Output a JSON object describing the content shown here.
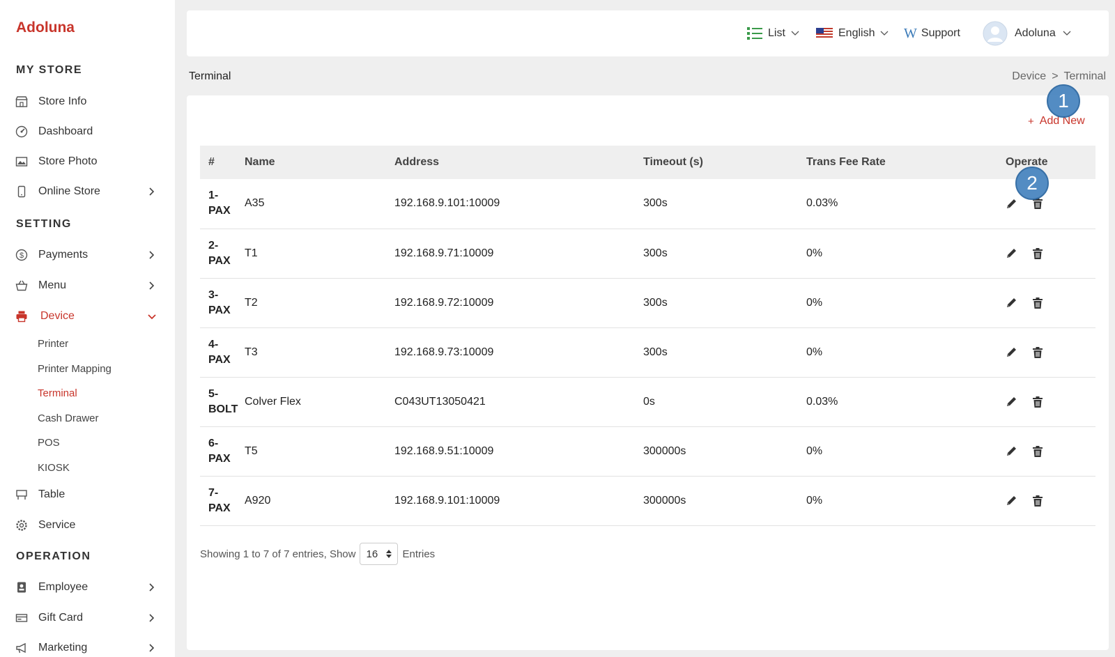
{
  "brand": "Adoluna",
  "colors": {
    "accent": "#c8352b",
    "badge": "#4a86c0"
  },
  "sidebar": {
    "sections": [
      "MY STORE",
      "SETTING",
      "OPERATION"
    ],
    "my_store": [
      {
        "label": "Store Info",
        "icon": "store-icon"
      },
      {
        "label": "Dashboard",
        "icon": "dashboard-icon"
      },
      {
        "label": "Store Photo",
        "icon": "photo-icon"
      },
      {
        "label": "Online Store",
        "icon": "phone-icon"
      }
    ],
    "setting": [
      {
        "label": "Payments",
        "icon": "dollar-icon"
      },
      {
        "label": "Menu",
        "icon": "basket-icon"
      },
      {
        "label": "Device",
        "icon": "printer-icon"
      }
    ],
    "device_sub": [
      "Printer",
      "Printer Mapping",
      "Terminal",
      "Cash Drawer",
      "POS",
      "KIOSK"
    ],
    "setting_more": [
      {
        "label": "Table",
        "icon": "table-icon"
      },
      {
        "label": "Service",
        "icon": "gear-icon"
      }
    ],
    "operation": [
      {
        "label": "Employee",
        "icon": "badge-icon"
      },
      {
        "label": "Gift Card",
        "icon": "gift-card-icon"
      },
      {
        "label": "Marketing",
        "icon": "megaphone-icon"
      }
    ]
  },
  "header": {
    "list_label": "List",
    "language": "English",
    "support": "Support",
    "user": "Adoluna"
  },
  "page": {
    "title": "Terminal",
    "breadcrumb": [
      "Device",
      ">",
      "Terminal"
    ],
    "add_new": "Add New"
  },
  "table": {
    "columns": [
      "#",
      "Name",
      "Address",
      "Timeout (s)",
      "Trans Fee Rate",
      "Operate"
    ],
    "rows": [
      {
        "idx1": "1-",
        "idx2": "PAX",
        "name": "A35",
        "address": "192.168.9.101:10009",
        "timeout": "300s",
        "fee": "0.03%"
      },
      {
        "idx1": "2-",
        "idx2": "PAX",
        "name": "T1",
        "address": "192.168.9.71:10009",
        "timeout": "300s",
        "fee": "0%"
      },
      {
        "idx1": "3-",
        "idx2": "PAX",
        "name": "T2",
        "address": "192.168.9.72:10009",
        "timeout": "300s",
        "fee": "0%"
      },
      {
        "idx1": "4-",
        "idx2": "PAX",
        "name": "T3",
        "address": "192.168.9.73:10009",
        "timeout": "300s",
        "fee": "0%"
      },
      {
        "idx1": "5-",
        "idx2": "BOLT",
        "name": "Colver Flex",
        "address": "C043UT13050421",
        "timeout": "0s",
        "fee": "0.03%"
      },
      {
        "idx1": "6-",
        "idx2": "PAX",
        "name": "T5",
        "address": "192.168.9.51:10009",
        "timeout": "300000s",
        "fee": "0%"
      },
      {
        "idx1": "7-",
        "idx2": "PAX",
        "name": "A920",
        "address": "192.168.9.101:10009",
        "timeout": "300000s",
        "fee": "0%"
      }
    ]
  },
  "footer": {
    "showing": "Showing 1 to 7 of 7 entries, Show",
    "page_size": "16",
    "entries": "Entries"
  },
  "badges": [
    "1",
    "2"
  ]
}
